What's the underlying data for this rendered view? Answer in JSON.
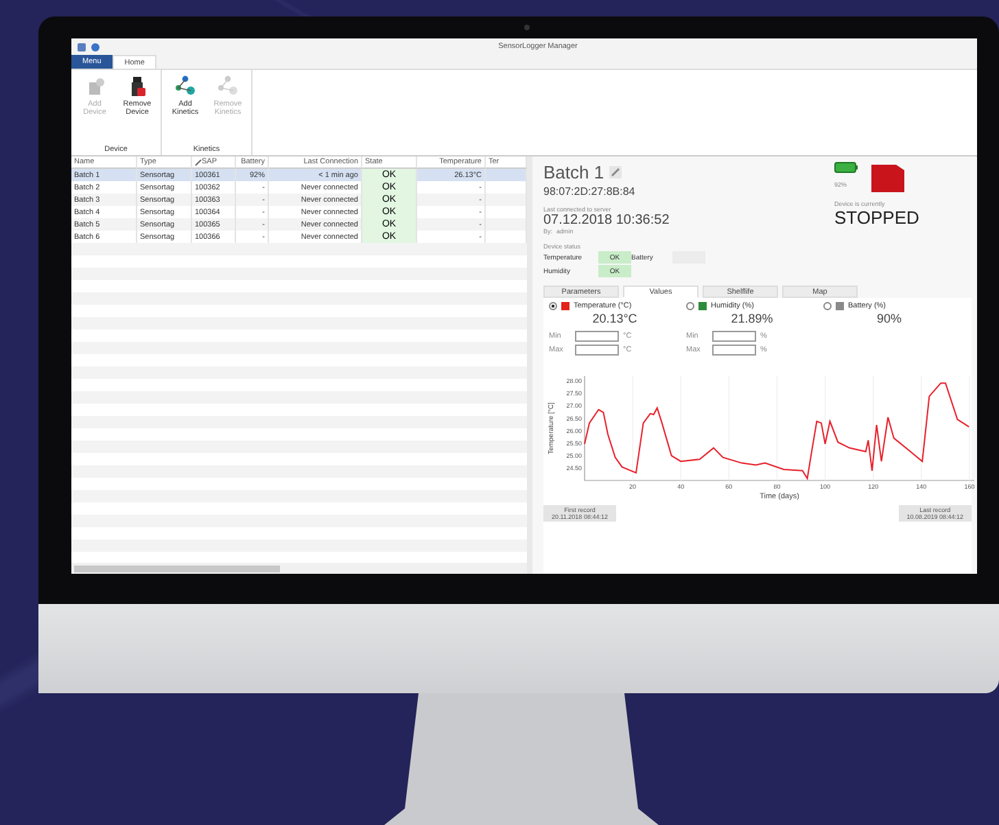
{
  "window": {
    "title": "SensorLogger Manager"
  },
  "ribbon_tabs": [
    {
      "label": "Menu",
      "kind": "menu",
      "selected": false
    },
    {
      "label": "Home",
      "kind": "tab",
      "selected": true
    }
  ],
  "ribbon_groups": [
    {
      "label": "Device",
      "buttons": [
        {
          "label": "Add Device",
          "disabled": true
        },
        {
          "label": "Remove Device",
          "disabled": false
        }
      ]
    },
    {
      "label": "Kinetics",
      "buttons": [
        {
          "label": "Add Kinetics",
          "disabled": false
        },
        {
          "label": "Remove Kinetics",
          "disabled": true
        }
      ]
    }
  ],
  "table": {
    "columns": [
      "Name",
      "Type",
      "SAP",
      "Battery",
      "Last Connection",
      "State",
      "Temperature",
      "Ter"
    ],
    "rows": [
      {
        "selected": true,
        "cells": [
          "Batch 1",
          "Sensortag",
          "100361",
          "92%",
          "< 1 min ago",
          "OK",
          "26.13°C"
        ]
      },
      {
        "selected": false,
        "cells": [
          "Batch 2",
          "Sensortag",
          "100362",
          "-",
          "Never connected",
          "OK",
          "-"
        ]
      },
      {
        "selected": false,
        "cells": [
          "Batch 3",
          "Sensortag",
          "100363",
          "-",
          "Never connected",
          "OK",
          "-"
        ]
      },
      {
        "selected": false,
        "cells": [
          "Batch 4",
          "Sensortag",
          "100364",
          "-",
          "Never connected",
          "OK",
          "-"
        ]
      },
      {
        "selected": false,
        "cells": [
          "Batch 5",
          "Sensortag",
          "100365",
          "-",
          "Never connected",
          "OK",
          "-"
        ]
      },
      {
        "selected": false,
        "cells": [
          "Batch 6",
          "Sensortag",
          "100366",
          "-",
          "Never connected",
          "OK",
          "-"
        ]
      }
    ]
  },
  "details": {
    "name": "Batch 1",
    "mac": "98:07:2D:27:8B:84",
    "last_connected_label": "Last connected to server",
    "last_connected": "07.12.2018 10:36:52",
    "by_label": "By:",
    "by": "admin",
    "battery": "92%",
    "state_label": "Device is currently",
    "state": "STOPPED",
    "status_label": "Device status",
    "status": [
      {
        "label": "Temperature",
        "value": "OK",
        "ok": true
      },
      {
        "label": "Battery",
        "ok": false
      },
      {
        "label": "Humidity",
        "value": "OK",
        "ok": true
      }
    ]
  },
  "panel_tabs": [
    {
      "label": "Parameters",
      "selected": false
    },
    {
      "label": "Values",
      "selected": true
    },
    {
      "label": "Shelflife",
      "selected": false
    },
    {
      "label": "Map",
      "selected": false
    }
  ],
  "readings": [
    {
      "label": "Temperature (°C)",
      "value": "20.13°C",
      "color": "#e32219",
      "selected": true,
      "limits": [
        {
          "label": "Min",
          "unit": "°C"
        },
        {
          "label": "Max",
          "unit": "°C"
        }
      ]
    },
    {
      "label": "Humidity (%)",
      "value": "21.89%",
      "color": "#2e8b3a",
      "selected": false,
      "limits": [
        {
          "label": "Min",
          "unit": "%"
        },
        {
          "label": "Max",
          "unit": "%"
        }
      ]
    },
    {
      "label": "Battery (%)",
      "value": "90%",
      "color": "#8a8a8a",
      "selected": false
    }
  ],
  "chart_data": {
    "type": "line",
    "grid": true,
    "xlabel": "Time (days)",
    "ylabel": "Temperature [°C]",
    "xlim": [
      0,
      162
    ],
    "ylim": [
      24.0,
      28.2
    ],
    "xticks": [
      20,
      40,
      60,
      80,
      100,
      120,
      140,
      160
    ],
    "yticks": [
      {
        "value": 24.5,
        "label": "24.50"
      },
      {
        "value": 25,
        "label": "25.00"
      },
      {
        "value": 25.5,
        "label": "25.50"
      },
      {
        "value": 26,
        "label": "26.00"
      },
      {
        "value": 26.5,
        "label": "26.50"
      },
      {
        "value": 27,
        "label": "27.00"
      },
      {
        "value": 27.5,
        "label": "27.50"
      },
      {
        "value": 28,
        "label": "28.00"
      }
    ],
    "x": [
      0,
      2,
      5.8,
      7.8,
      9.7,
      12.7,
      15.6,
      21.4,
      24.4,
      27.3,
      28.7,
      30.2,
      32.2,
      36.1,
      40,
      47.8,
      53.6,
      57.5,
      65.3,
      71.2,
      75,
      82.8,
      90.6,
      92.6,
      94.5,
      96.5,
      98.4,
      100,
      102,
      105.3,
      110.1,
      116.9,
      117.9,
      119.5,
      121.4,
      123.4,
      126.1,
      128.6,
      135.5,
      140.4,
      143.3,
      148.1,
      150,
      155,
      159.8
    ],
    "series": [
      {
        "color": "#e8202a",
        "values": [
          25.47,
          26.31,
          26.85,
          26.74,
          25.85,
          24.93,
          24.54,
          24.31,
          26.31,
          26.69,
          26.65,
          26.92,
          26.31,
          25.0,
          24.77,
          24.85,
          25.31,
          24.93,
          24.7,
          24.62,
          24.7,
          24.44,
          24.39,
          24.08,
          25.23,
          26.38,
          26.31,
          25.47,
          26.38,
          25.54,
          25.31,
          25.16,
          25.62,
          24.39,
          26.23,
          24.77,
          26.54,
          25.7,
          25.16,
          24.77,
          27.39,
          27.92,
          27.92,
          26.46,
          26.16
        ]
      }
    ]
  },
  "first_record": {
    "label": "First record",
    "value": "20.11.2018 08:44:12"
  },
  "last_record": {
    "label": "Last record",
    "value": "10.08.2019 08:44:12"
  }
}
